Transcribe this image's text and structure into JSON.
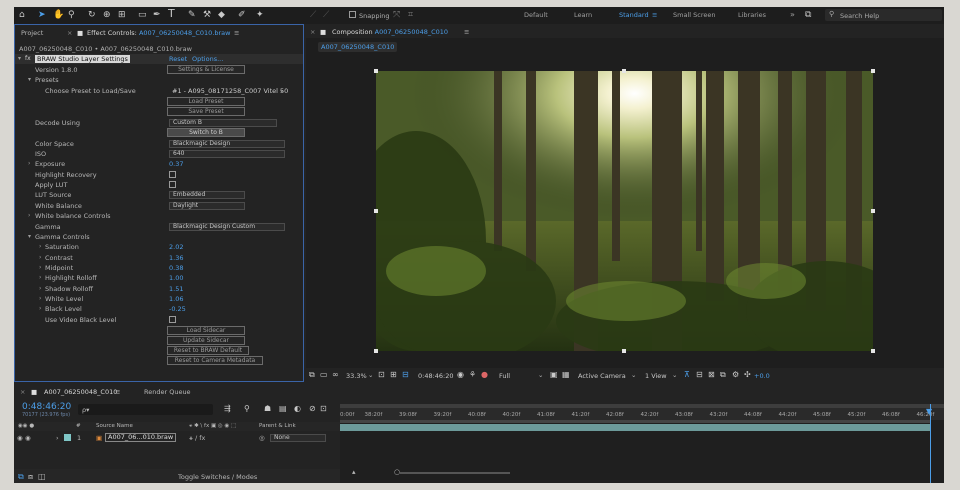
{
  "toolbar": {
    "snapping_label": "Snapping",
    "workspaces": [
      "Default",
      "Learn",
      "Standard",
      "Small Screen",
      "Libraries"
    ],
    "active_workspace": "Standard",
    "search_placeholder": "Search Help"
  },
  "project_panel": {
    "tab_label": "Project"
  },
  "effect_controls": {
    "tab_label": "Effect Controls:",
    "tab_file": "A007_06250048_C010.braw",
    "breadcrumb": "A007_06250048_C010 • A007_06250048_C010.braw",
    "effect_name": "BRAW Studio Layer Settings",
    "reset_label": "Reset",
    "options_label": "Options...",
    "version": "Version 1.8.0",
    "settings_button": "Settings & License",
    "presets_label": "Presets",
    "choose_preset_label": "Choose Preset to Load/Save",
    "preset_value": "#1 - A095_08171258_C007 Vitel 50",
    "load_preset": "Load Preset",
    "save_preset": "Save Preset",
    "decode_using_label": "Decode Using",
    "decode_using_value": "Custom B",
    "switch_button": "Switch to B",
    "color_space_label": "Color Space",
    "color_space_value": "Blackmagic Design",
    "iso_label": "ISO",
    "iso_value": "640",
    "exposure_label": "Exposure",
    "exposure_value": "0.37",
    "highlight_recovery_label": "Highlight Recovery",
    "apply_lut_label": "Apply LUT",
    "lut_source_label": "LUT Source",
    "lut_source_value": "Embedded",
    "white_balance_label": "White Balance",
    "white_balance_value": "Daylight",
    "wb_controls_label": "White balance Controls",
    "gamma_label": "Gamma",
    "gamma_value": "Blackmagic Design Custom",
    "gamma_controls_label": "Gamma Controls",
    "gamma_params": [
      {
        "label": "Saturation",
        "value": "2.02"
      },
      {
        "label": "Contrast",
        "value": "1.36"
      },
      {
        "label": "Midpoint",
        "value": "0.38"
      },
      {
        "label": "Highlight Rolloff",
        "value": "1.00"
      },
      {
        "label": "Shadow Rolloff",
        "value": "1.51"
      },
      {
        "label": "White Level",
        "value": "1.06"
      },
      {
        "label": "Black Level",
        "value": "-0.25"
      }
    ],
    "use_video_black_label": "Use Video Black Level",
    "load_sidecar": "Load Sidecar",
    "update_sidecar": "Update Sidecar",
    "reset_braw": "Reset to BRAW Default",
    "reset_camera": "Reset to Camera Metadata"
  },
  "composition": {
    "tab_label": "Composition",
    "tab_name": "A007_06250048_C010",
    "sub_tab": "A007_06250048_C010",
    "zoom": "33.3%",
    "timecode": "0:48:46:20",
    "resolution": "Full",
    "camera": "Active Camera",
    "views": "1 View",
    "exposure_offset": "+0.0"
  },
  "timeline": {
    "tab_label": "A007_06250048_C010",
    "render_queue_label": "Render Queue",
    "timecode": "0:48:46:20",
    "fps_info": "70177 (23.976 fps)",
    "search_placeholder": "ρ▾",
    "col_number": "#",
    "col_source": "Source Name",
    "col_parent": "Parent & Link",
    "layer_number": "1",
    "layer_name": "A007_06...010.braw",
    "parent_value": "None",
    "toggle_label": "Toggle Switches / Modes",
    "ticks": [
      "0:00f",
      "38:20f",
      "39:08f",
      "39:20f",
      "40:08f",
      "40:20f",
      "41:08f",
      "41:20f",
      "42:08f",
      "42:20f",
      "43:08f",
      "43:20f",
      "44:08f",
      "44:20f",
      "45:08f",
      "45:20f",
      "46:08f",
      "46:20f"
    ]
  }
}
